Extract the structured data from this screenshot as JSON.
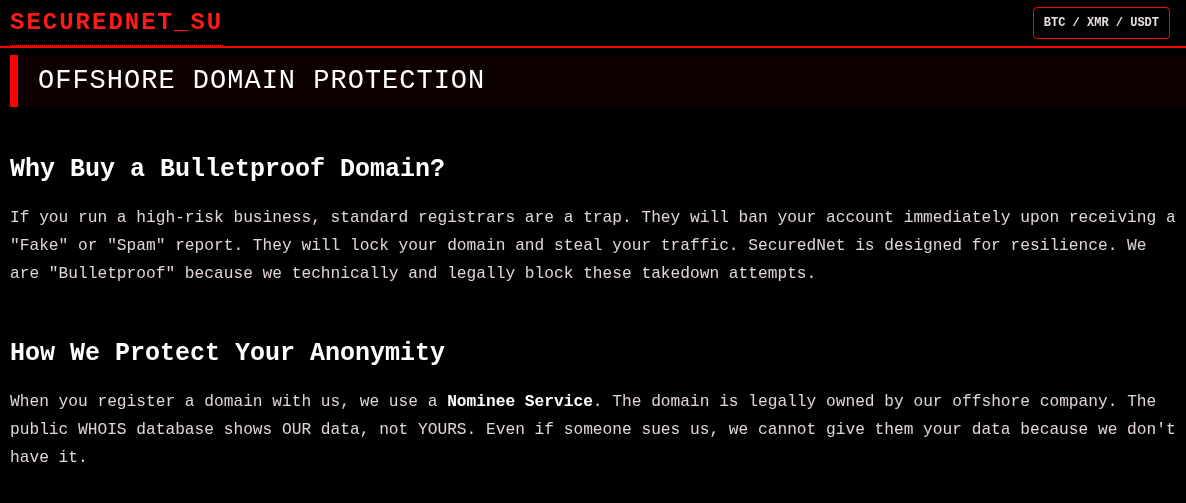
{
  "header": {
    "logo": "SECUREDNET_SU",
    "payment_badge": "BTC / XMR / USDT"
  },
  "page_title": "OFFSHORE DOMAIN PROTECTION",
  "sections": [
    {
      "heading": "Why Buy a Bulletproof Domain?",
      "body": "If you run a high-risk business, standard registrars are a trap. They will ban your account immediately upon receiving a \"Fake\" or \"Spam\" report. They will lock your domain and steal your traffic. SecuredNet is designed for resilience. We are \"Bulletproof\" because we technically and legally block these takedown attempts."
    },
    {
      "heading": "How We Protect Your Anonymity",
      "body": "When you register a domain with us, we use a **Nominee Service**. The domain is legally owned by our offshore company. The public WHOIS database shows OUR data, not YOURS. Even if someone sues us, we cannot give them your data because we don't have it."
    }
  ]
}
